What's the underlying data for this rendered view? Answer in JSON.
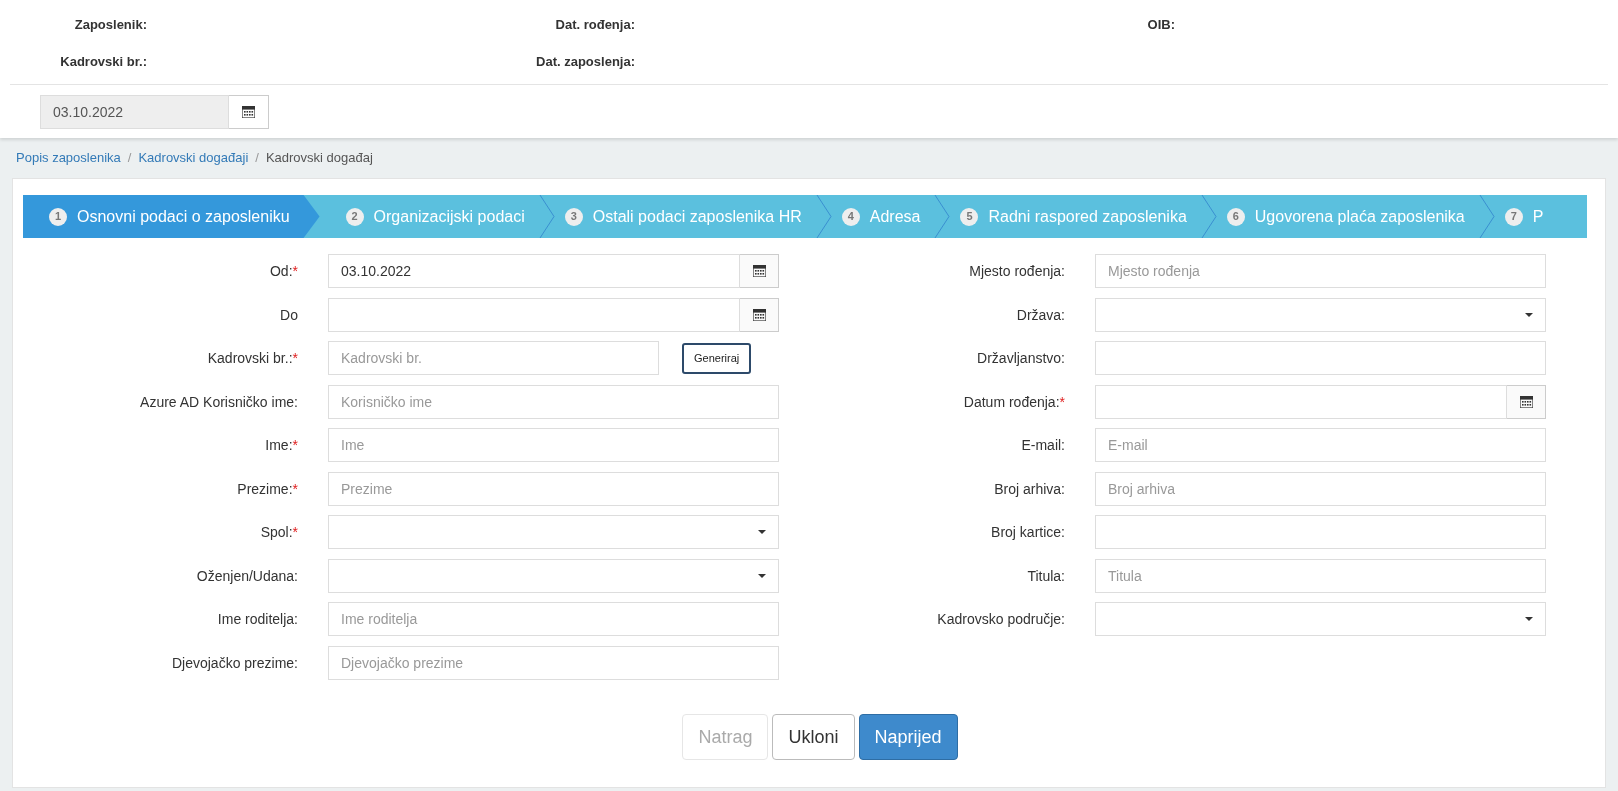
{
  "header": {
    "fields": [
      {
        "label": "Zaposlenik:"
      },
      {
        "label": "Dat. rođenja:"
      },
      {
        "label": "OIB:"
      },
      {
        "label": "Kadrovski br.:"
      },
      {
        "label": "Dat. zaposlenja:"
      }
    ],
    "date": {
      "value": "03.10.2022"
    }
  },
  "breadcrumb": [
    {
      "label": "Popis zaposlenika",
      "kind": "link"
    },
    {
      "separator": "/",
      "label": "Kadrovski događaji",
      "kind": "link"
    },
    {
      "separator": "/",
      "label": "Kadrovski događaj",
      "kind": "current"
    }
  ],
  "steps": [
    {
      "number": "1",
      "label": "Osnovni podaci o zaposleniku",
      "selected": true
    },
    {
      "number": "2",
      "label": "Organizacijski podaci",
      "selected": false
    },
    {
      "number": "3",
      "label": "Ostali podaci zaposlenika HR",
      "selected": false
    },
    {
      "number": "4",
      "label": "Adresa",
      "selected": false
    },
    {
      "number": "5",
      "label": "Radni raspored zaposlenika",
      "selected": false
    },
    {
      "number": "6",
      "label": "Ugovorena plaća zaposlenika",
      "selected": false
    },
    {
      "number": "7",
      "label": "P",
      "selected": false
    }
  ],
  "left_fields": [
    {
      "label": "Od:",
      "marker": "*",
      "kind": "date",
      "value": "03.10.2022"
    },
    {
      "label": "Do",
      "kind": "date"
    },
    {
      "label": "Kadrovski br.:",
      "marker": "*",
      "kind": "text-button",
      "placeholder": "Kadrovski br.",
      "button": "Generiraj"
    },
    {
      "label": "Azure AD Korisničko ime:",
      "kind": "text",
      "placeholder": "Korisničko ime"
    },
    {
      "label": "Ime:",
      "marker": "*",
      "kind": "text",
      "placeholder": "Ime"
    },
    {
      "label": "Prezime:",
      "marker": "*",
      "kind": "text",
      "placeholder": "Prezime"
    },
    {
      "label": "Spol:",
      "marker": "*",
      "kind": "select"
    },
    {
      "label": "Oženjen/Udana:",
      "kind": "select"
    },
    {
      "label": "Ime roditelja:",
      "kind": "text",
      "placeholder": "Ime roditelja"
    },
    {
      "label": "Djevojačko prezime:",
      "kind": "text",
      "placeholder": "Djevojačko prezime"
    }
  ],
  "right_fields": [
    {
      "label": "Mjesto rođenja:",
      "kind": "text",
      "placeholder": "Mjesto rođenja"
    },
    {
      "label": "Država:",
      "kind": "select"
    },
    {
      "label": "Državljanstvo:",
      "kind": "text"
    },
    {
      "label": "Datum rođenja:",
      "marker": "*",
      "kind": "date"
    },
    {
      "label": "E-mail:",
      "kind": "text",
      "placeholder": "E-mail"
    },
    {
      "label": "Broj arhiva:",
      "kind": "text",
      "placeholder": "Broj arhiva"
    },
    {
      "label": "Broj kartice:",
      "kind": "text"
    },
    {
      "label": "Titula:",
      "kind": "text",
      "placeholder": "Titula"
    },
    {
      "label": "Kadrovsko područje:",
      "kind": "select"
    }
  ],
  "buttons": [
    {
      "label": "Natrag",
      "kind": "default",
      "disabled": true
    },
    {
      "label": "Ukloni",
      "kind": "default",
      "disabled": false
    },
    {
      "label": "Naprijed",
      "kind": "primary",
      "disabled": false
    }
  ]
}
